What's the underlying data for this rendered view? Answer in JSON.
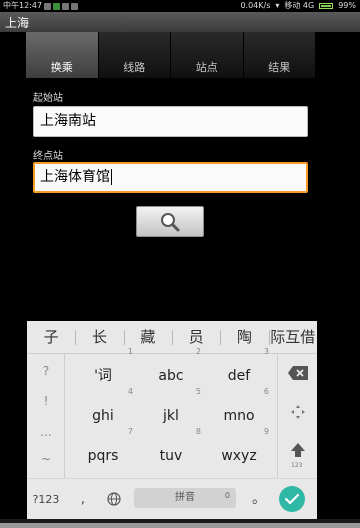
{
  "status_bar": {
    "carrier_time": "中午12:47",
    "speed": "0.04K/s",
    "network": "移动 4G",
    "battery": "99%"
  },
  "title": "上海",
  "tabs": [
    {
      "label": "换乘",
      "active": true
    },
    {
      "label": "线路",
      "active": false
    },
    {
      "label": "站点",
      "active": false
    },
    {
      "label": "结果",
      "active": false
    }
  ],
  "form": {
    "start_label": "起始站",
    "start_value": "上海南站",
    "end_label": "终点站",
    "end_value": "上海体育馆"
  },
  "keyboard": {
    "candidates": [
      "子",
      "长",
      "藏",
      "员",
      "陶",
      "际互借"
    ],
    "symbols": [
      "?",
      "!",
      "...",
      "~"
    ],
    "keys": [
      {
        "label": "'词",
        "num": "1"
      },
      {
        "label": "abc",
        "num": "2"
      },
      {
        "label": "def",
        "num": "3"
      },
      {
        "label": "ghi",
        "num": "4"
      },
      {
        "label": "jkl",
        "num": "5"
      },
      {
        "label": "mno",
        "num": "6"
      },
      {
        "label": "pqrs",
        "num": "7"
      },
      {
        "label": "tuv",
        "num": "8"
      },
      {
        "label": "wxyz",
        "num": "9"
      }
    ],
    "switch_label": "?123",
    "comma": ",",
    "space_label": "拼音",
    "space_num": "0",
    "period": "。",
    "enter_sub": "123"
  },
  "colors": {
    "focus_border": "#f39c2a",
    "confirm": "#30b8a6"
  }
}
